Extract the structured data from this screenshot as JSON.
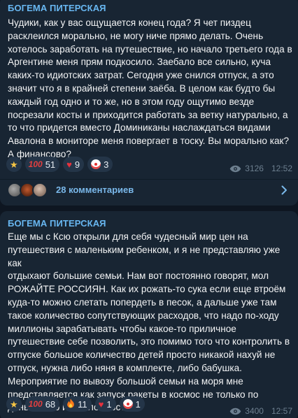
{
  "posts": [
    {
      "channel": "БОГЕМА ПИТЕРСКАЯ",
      "text": "Чудики, как у вас ощущается конец года? Я чет пиздец\nрасклеился морально, не могу ниче прямо делать. Очень\nхотелось заработать на путешествие, но начало третьего года в\nАргентине меня прям подкосило. Заебало все сильно, куча\nкаких-то идиотских затрат. Сегодня уже снился отпуск, а это\nзначит что я в крайней степени заёба. В целом как будто бы\nкаждый год одно и то же, но в этом году ощутимо везде\nпосрезали косты и приходится работать за ветку натурально, а\nто что придется вместо Доминиканы наслаждаться видами\nАвалона в мониторе меня повергает в тоску. Вы морально как?\nА финансово?",
      "reactions": [
        {
          "icon": "star-emoji",
          "glyph": "★",
          "count": ""
        },
        {
          "icon": "hundred-points-emoji",
          "glyph": "100",
          "count": "51"
        },
        {
          "icon": "heart-emoji",
          "glyph": "♥",
          "count": "9"
        },
        {
          "icon": "clown-emoji",
          "glyph": "",
          "count": "3"
        }
      ],
      "views": "3126",
      "time": "12:52",
      "comments_label": "28 комментариев"
    },
    {
      "channel": "БОГЕМА ПИТЕРСКАЯ",
      "text": "Еще мы с Ксю открыли для себя чудесный мир цен на\nпутешествия с маленьким ребенком, и я не представляю уже как\nотдыхают большие семьи. Нам вот постоянно говорят, мол\nРОЖАЙТЕ РОССИЯН. Как их рожать-то сука если еще втроём\nкуда-то можно слетать попердеть в песок, а дальше уже там\nтакое количество сопутствующих расходов, что надо по-ходу\nмиллионы зарабатывать чтобы какое-то приличное\nпутешествие себе позволить, это помимо того что контролить в\nотпуске большое количество детей просто никакой нахуй не\nотпуск, нужна либо няня в комплекте, либо бабушка.\nМероприятие по вывозу большой семьи на моря мне\nпредставляется как запуск ракеты в космос не только по\nденьгам, но и по сложности.",
      "reactions": [
        {
          "icon": "star-emoji",
          "glyph": "★",
          "count": ""
        },
        {
          "icon": "hundred-points-emoji",
          "glyph": "100",
          "count": "68"
        },
        {
          "icon": "fire-emoji",
          "glyph": "🔥",
          "count": "11"
        },
        {
          "icon": "heart-emoji",
          "glyph": "♥",
          "count": "1"
        },
        {
          "icon": "clown-emoji",
          "glyph": "",
          "count": "1"
        }
      ],
      "views": "3400",
      "time": "12:57"
    }
  ],
  "colors": {
    "background": "#0e1621",
    "bubble": "#182533",
    "channel_name": "#68b7f1",
    "reaction_pill": "#243548",
    "meta_text": "#6d7f8f"
  }
}
